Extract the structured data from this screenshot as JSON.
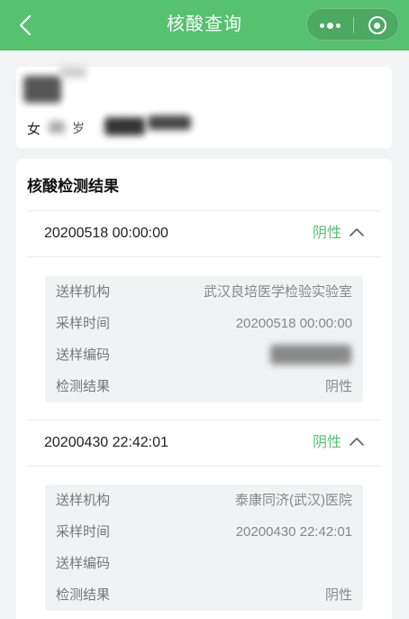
{
  "navbar": {
    "title": "核酸查询",
    "back_icon": "chevron-left-icon",
    "more_icon": "more-dots-icon",
    "close_icon": "target-circle-icon",
    "color": "#56c16f"
  },
  "person": {
    "gender": "女",
    "age_unit": "岁"
  },
  "results": {
    "title": "核酸检测结果",
    "positive_color": "#56c16f",
    "records": [
      {
        "date": "20200518 00:00:00",
        "status": "阴性",
        "details": [
          {
            "label": "送样机构",
            "value": "武汉良培医学检验实验室"
          },
          {
            "label": "采样时间",
            "value": "20200518 00:00:00"
          },
          {
            "label": "送样编码",
            "value": ""
          },
          {
            "label": "检测结果",
            "value": "阴性"
          }
        ]
      },
      {
        "date": "20200430 22:42:01",
        "status": "阴性",
        "details": [
          {
            "label": "送样机构",
            "value": "泰康同济(武汉)医院"
          },
          {
            "label": "采样时间",
            "value": "20200430 22:42:01"
          },
          {
            "label": "送样编码",
            "value": ""
          },
          {
            "label": "检测结果",
            "value": "阴性"
          }
        ]
      }
    ]
  }
}
